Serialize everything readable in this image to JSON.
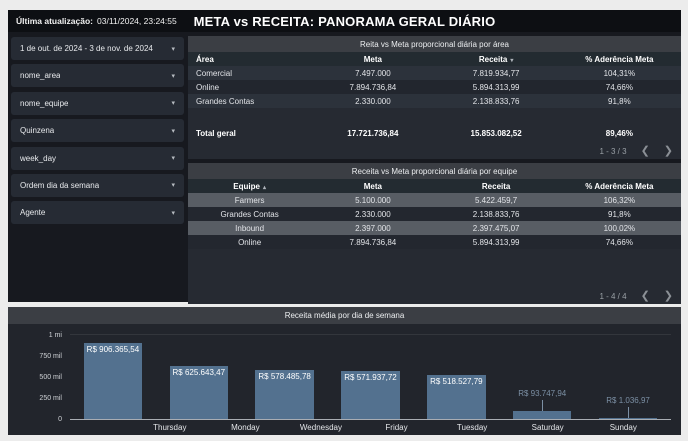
{
  "header": {
    "last_update_label": "Última atualização:",
    "last_update_value": "03/11/2024, 23:24:55",
    "title": "META vs RECEITA: PANORAMA GERAL DIÁRIO"
  },
  "icons": {
    "dropdown_arrow": "▾",
    "sort_desc": "▾",
    "sort_asc": "▴",
    "chevron_left": "❮",
    "chevron_right": "❯"
  },
  "filters": [
    {
      "label": "1 de out. de 2024 - 3 de nov. de 2024"
    },
    {
      "label": "nome_area"
    },
    {
      "label": "nome_equipe"
    },
    {
      "label": "Quinzena"
    },
    {
      "label": "week_day"
    },
    {
      "label": "Ordem dia da semana"
    },
    {
      "label": "Agente"
    }
  ],
  "area_table": {
    "title": "Reita vs Meta proporcional diária por área",
    "columns": {
      "c0": "Área",
      "c1": "Meta",
      "c2": "Receita",
      "c3": "% Aderência Meta"
    },
    "sorted_by": "Receita",
    "rows": [
      {
        "name": "Comercial",
        "meta": "7.497.000",
        "receita": "7.819.934,77",
        "aderencia": "104,31%"
      },
      {
        "name": "Online",
        "meta": "7.894.736,84",
        "receita": "5.894.313,99",
        "aderencia": "74,66%"
      },
      {
        "name": "Grandes Contas",
        "meta": "2.330.000",
        "receita": "2.138.833,76",
        "aderencia": "91,8%"
      }
    ],
    "total": {
      "label": "Total geral",
      "meta": "17.721.736,84",
      "receita": "15.853.082,52",
      "aderencia": "89,46%"
    },
    "pagination": "1 - 3 / 3"
  },
  "equipe_table": {
    "title": "Receita vs Meta proporcional diária por equipe",
    "columns": {
      "c0": "Equipe",
      "c1": "Meta",
      "c2": "Receita",
      "c3": "% Aderência Meta"
    },
    "sorted_by": "Equipe",
    "rows": [
      {
        "name": "Farmers",
        "meta": "5.100.000",
        "receita": "5.422.459,7",
        "aderencia": "106,32%"
      },
      {
        "name": "Grandes Contas",
        "meta": "2.330.000",
        "receita": "2.138.833,76",
        "aderencia": "91,8%"
      },
      {
        "name": "Inbound",
        "meta": "2.397.000",
        "receita": "2.397.475,07",
        "aderencia": "100,02%"
      },
      {
        "name": "Online",
        "meta": "7.894.736,84",
        "receita": "5.894.313,99",
        "aderencia": "74,66%"
      }
    ],
    "pagination": "1 - 4 / 4"
  },
  "chart_data": {
    "type": "bar",
    "title": "Receita média por dia de semana",
    "categories": [
      "Thursday",
      "Monday",
      "Wednesday",
      "Friday",
      "Tuesday",
      "Saturday",
      "Sunday"
    ],
    "values": [
      906365.54,
      625643.47,
      578485.78,
      571937.72,
      518527.79,
      93747.94,
      1036.97
    ],
    "value_labels": [
      "R$ 906.365,54",
      "R$ 625.643,47",
      "R$ 578.485,78",
      "R$ 571.937,72",
      "R$ 518.527,79",
      "R$ 93.747,94",
      "R$ 1.036,97"
    ],
    "y_ticks": [
      "1 mi",
      "750 mil",
      "500 mil",
      "250 mil",
      "0"
    ],
    "ylim": [
      0,
      1000000
    ],
    "xlabel": "",
    "ylabel": "",
    "grid": "minimal",
    "legend": "none",
    "bar_color": "#53718f",
    "inside_label_color": "#ffffff",
    "outside_label_color": "#7c90a5"
  }
}
